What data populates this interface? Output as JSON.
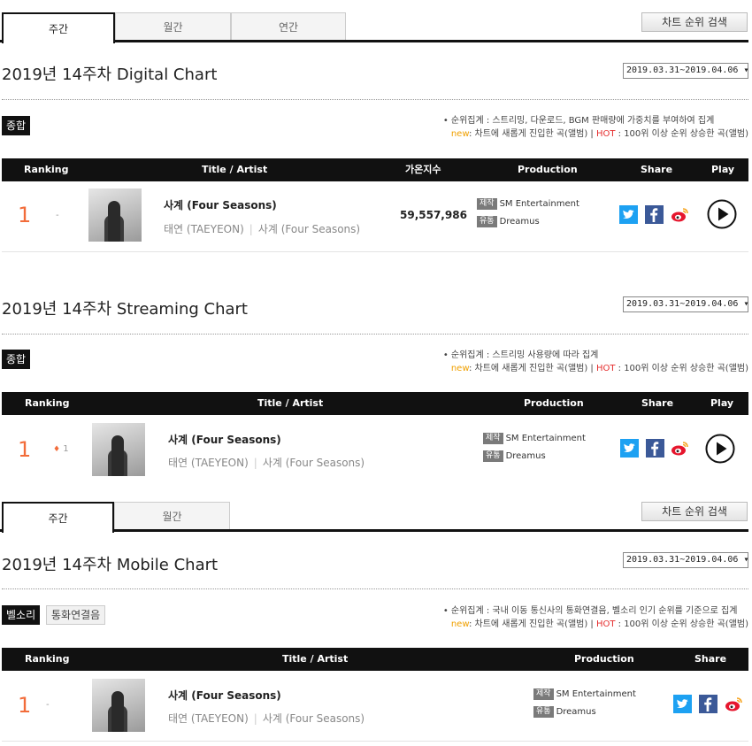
{
  "top_tabs": {
    "weekly": "주간",
    "monthly": "월간",
    "yearly": "연간",
    "search": "차트 순위 검색"
  },
  "bottom_tabs": {
    "weekly": "주간",
    "monthly": "월간",
    "search": "차트 순위 검색"
  },
  "digital": {
    "title": "2019년 14주차 Digital Chart",
    "date": "2019.03.31~2019.04.06 ▾",
    "category": "종합",
    "note_prefix": "• 순위집계 : 스트리밍, 다운로드, BGM 판매량에 가중치를 부여하여 집계",
    "legend_new": "new",
    "legend_new_text": ": 차트에 새롭게 진입한 곡(앨범) | ",
    "legend_hot": "HOT",
    "legend_hot_text": " : 100위 이상 순위 상승한 곡(앨범)",
    "headers": {
      "ranking": "Ranking",
      "title": "Title / Artist",
      "score": "가온지수",
      "production": "Production",
      "share": "Share",
      "play": "Play"
    },
    "entry": {
      "rank": "1",
      "change": "-",
      "song": "사계 (Four Seasons)",
      "artist": "태연 (TAEYEON)",
      "album": "사계 (Four Seasons)",
      "score": "59,557,986",
      "prod_tag": "제작",
      "prod_name": "SM Entertainment",
      "dist_tag": "유통",
      "dist_name": "Dreamus"
    }
  },
  "streaming": {
    "title": "2019년 14주차 Streaming Chart",
    "date": "2019.03.31~2019.04.06 ▾",
    "category": "종합",
    "note_prefix": "• 순위집계 : 스트리밍 사용량에 따라 집계",
    "legend_new": "new",
    "legend_new_text": ": 차트에 새롭게 진입한 곡(앨범) | ",
    "legend_hot": "HOT",
    "legend_hot_text": " : 100위 이상 순위 상승한 곡(앨범)",
    "headers": {
      "ranking": "Ranking",
      "title": "Title / Artist",
      "production": "Production",
      "share": "Share",
      "play": "Play"
    },
    "entry": {
      "rank": "1",
      "change_arrow": "♦",
      "change": "1",
      "song": "사계 (Four Seasons)",
      "artist": "태연 (TAEYEON)",
      "album": "사계 (Four Seasons)",
      "prod_tag": "제작",
      "prod_name": "SM Entertainment",
      "dist_tag": "유통",
      "dist_name": "Dreamus"
    }
  },
  "mobile": {
    "title": "2019년 14주차 Mobile Chart",
    "date": "2019.03.31~2019.04.06 ▾",
    "category_active": "벨소리",
    "category_other": "통화연결음",
    "note_prefix": "• 순위집계 : 국내 이동 통신사의 통화연결음, 벨소리 인기 순위를 기준으로 집계",
    "legend_new": "new",
    "legend_new_text": ": 차트에 새롭게 진입한 곡(앨범) | ",
    "legend_hot": "HOT",
    "legend_hot_text": " : 100위 이상 순위 상승한 곡(앨범)",
    "headers": {
      "ranking": "Ranking",
      "title": "Title / Artist",
      "production": "Production",
      "share": "Share"
    },
    "entry": {
      "rank": "1",
      "change": "-",
      "song": "사계 (Four Seasons)",
      "artist": "태연 (TAEYEON)",
      "album": "사계 (Four Seasons)",
      "prod_tag": "제작",
      "prod_name": "SM Entertainment",
      "dist_tag": "유통",
      "dist_name": "Dreamus"
    }
  },
  "icons": {
    "twitter": "twitter-icon",
    "facebook": "facebook-icon",
    "weibo": "weibo-icon",
    "play": "play-icon"
  },
  "colors": {
    "rank": "#f26c3a",
    "new": "#f0a000",
    "hot": "#e52d2d",
    "twitter": "#1da1f2",
    "facebook": "#3b5998"
  }
}
